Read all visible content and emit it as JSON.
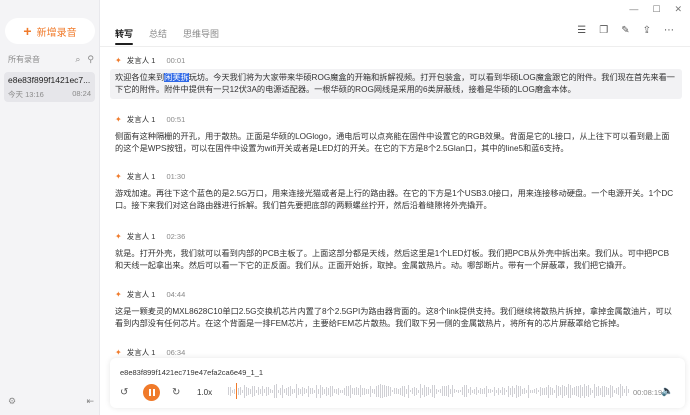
{
  "sidebar": {
    "new_recording": "新增录音",
    "all_recordings": "所有录音",
    "items": [
      {
        "name": "e8e83f899f1421ec7...",
        "date": "今天 13:16",
        "duration": "08:24"
      }
    ]
  },
  "tabs": [
    "转写",
    "总结",
    "思维导图"
  ],
  "active_tab": "转写",
  "segments": [
    {
      "speaker": "发言人 1",
      "time": "00:01",
      "text_pre": "欢迎各位来到",
      "text_highlight": "闲芙拆",
      "text_post": "玩坊。今天我们将为大家带来华硕ROG魔盒的开箱和拆解视频。打开包装盒，可以看到华硕LOG魔盒跟它的附件。我们现在首先来看一下它的附件。附件中提供有一只12伏3A的电源适配器。一根华硕的ROG网线是采用的6类屏蔽线，接着是华硕的LOG磨盒本体。"
    },
    {
      "speaker": "发言人 1",
      "time": "00:51",
      "text": "侧面有这种隔栅的开孔，用于散热。正面是华硕的LOGlogo，通电后可以点亮能在固件中设置它的RGB效果。背面是它的L接口，从上往下可以看到最上面的这个是WPS按钮，可以在固件中设置为wifi开关或者是LED灯的开关。在它的下方是8个2.5Glan口，其中的line5和蓝6支持。"
    },
    {
      "speaker": "发言人 1",
      "time": "01:30",
      "text": "游戏加速。再往下这个蓝色的是2.5G万口，用来连接光猫或者是上行的路由器。在它的下方是1个USB3.0接口，用来连接移动硬盘。一个电源开关。1个DC口。接下来我们对这台路由器进行拆解。我们首先要把底部的两颗螺丝拧开，然后沿着缝隙将外壳撬开。"
    },
    {
      "speaker": "发言人 1",
      "time": "02:36",
      "text": "就是。打开外壳，我们就可以看到内部的PCB主板了。上面这部分都是天线，然后这里是1个LED灯板。我们把PCB从外壳中拆出来。我们从。可中把PCB和天线一起拿出来。然后可以看一下它的正反面。我们从。正面开始拆，取掉。金属散热片。动。哪部断片。带有一个屏蔽罩，我们把它撬开。"
    },
    {
      "speaker": "发言人 1",
      "time": "04:44",
      "text": "这是一颗麦灵的MXL8628C10单口2.5G交换机芯片内置了8个2.5GPI为路由器背面的。这8个link提供支持。我们继续将散热片拆掉，拿掉金属散油片，可以看到内部没有任何芯片。在这个背面是一排FEM芯片，主要给FEM芯片散热。我们取下另一侧的金属散热片，将所有的芯片屏蔽罩给它拆掉。"
    },
    {
      "speaker": "发言人 1",
      "time": "06:34",
      "text": ""
    }
  ],
  "player": {
    "filename": "e8e83f899f1421ec719e47efa2ca6e49_1_1",
    "speed": "1.0x",
    "current_time": "00:08:19",
    "progress": 0.02
  },
  "colors": {
    "accent": "#f07a2a",
    "highlight": "#2f68e6"
  }
}
